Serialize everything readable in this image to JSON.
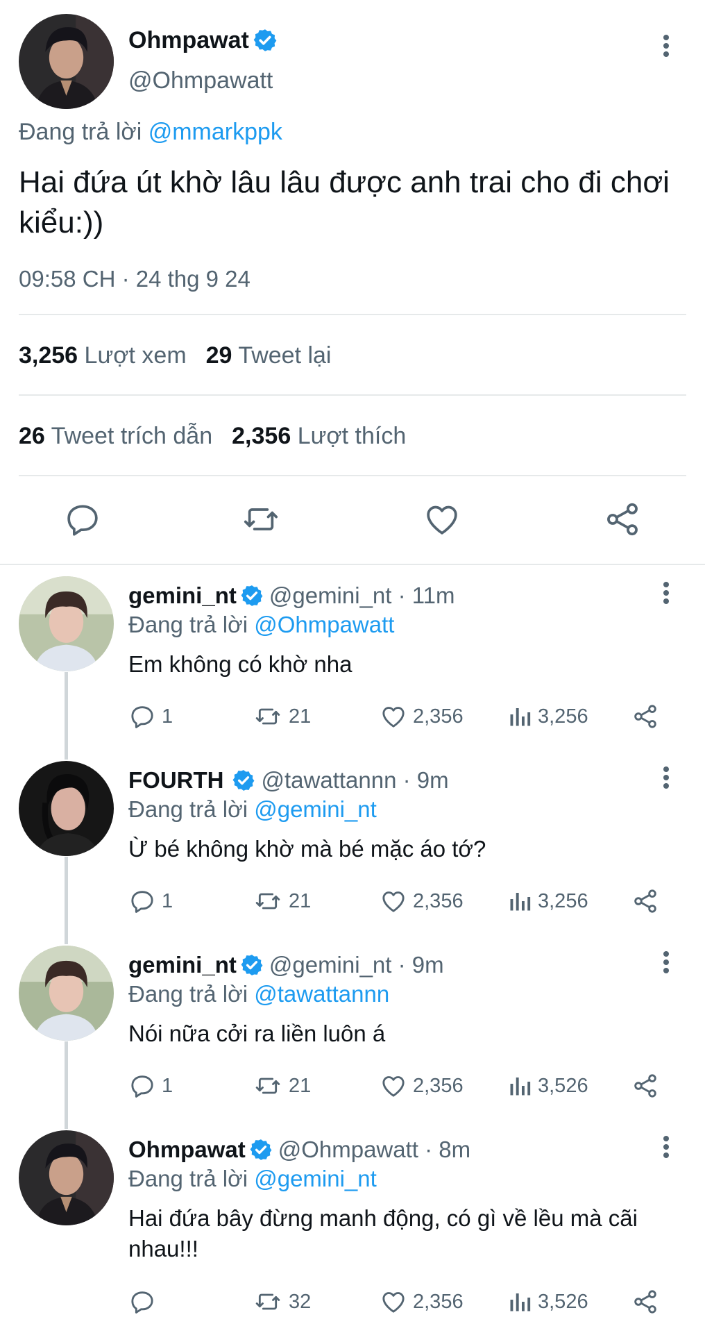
{
  "main_tweet": {
    "name": "Ohmpawat",
    "handle": "@Ohmpawatt",
    "reply_prefix": "Đang trả lời",
    "reply_mention": "@mmarkppk",
    "text": "Hai đứa út khờ lâu lâu được anh trai cho đi chơi kiểu:))",
    "timestamp": "09:58 CH · 24 thg 9 24",
    "stats": {
      "views_count": "3,256",
      "views_label": "Lượt xem",
      "retweets_count": "29",
      "retweets_label": "Tweet lại",
      "quotes_count": "26",
      "quotes_label": "Tweet trích dẫn",
      "likes_count": "2,356",
      "likes_label": "Lượt thích"
    },
    "icons": [
      "reply-icon",
      "retweet-icon",
      "like-icon",
      "share-icon"
    ]
  },
  "replies": [
    {
      "name": "gemini_nt",
      "handle": "@gemini_nt · 11m",
      "reply_prefix": "Đang trả lời",
      "reply_mention": "@Ohmpawatt",
      "text": "Em không có khờ nha",
      "reply_count": "1",
      "retweet_count": "21",
      "like_count": "2,356",
      "view_count": "3,256"
    },
    {
      "name": "FOURTH",
      "handle": "@tawattannn · 9m",
      "reply_prefix": "Đang trả lời",
      "reply_mention": "@gemini_nt",
      "text": "Ừ bé không khờ mà bé mặc áo tớ?",
      "reply_count": "1",
      "retweet_count": "21",
      "like_count": "2,356",
      "view_count": "3,256"
    },
    {
      "name": "gemini_nt",
      "handle": "@gemini_nt · 9m",
      "reply_prefix": "Đang trả lời",
      "reply_mention": "@tawattannn",
      "text": "Nói nữa cởi ra liền luôn á",
      "reply_count": "1",
      "retweet_count": "21",
      "like_count": "2,356",
      "view_count": "3,526"
    },
    {
      "name": "Ohmpawat",
      "handle": "@Ohmpawatt · 8m",
      "reply_prefix": "Đang trả lời",
      "reply_mention": "@gemini_nt",
      "text": "Hai đứa bây đừng manh động, có gì về lều mà cãi nhau!!!",
      "reply_count": "",
      "retweet_count": "32",
      "like_count": "2,356",
      "view_count": "3,526"
    }
  ],
  "colors": {
    "accent": "#1d9bf0",
    "secondary_text": "#536471",
    "primary_text": "#0f1419",
    "divider": "#e6e9ea"
  }
}
